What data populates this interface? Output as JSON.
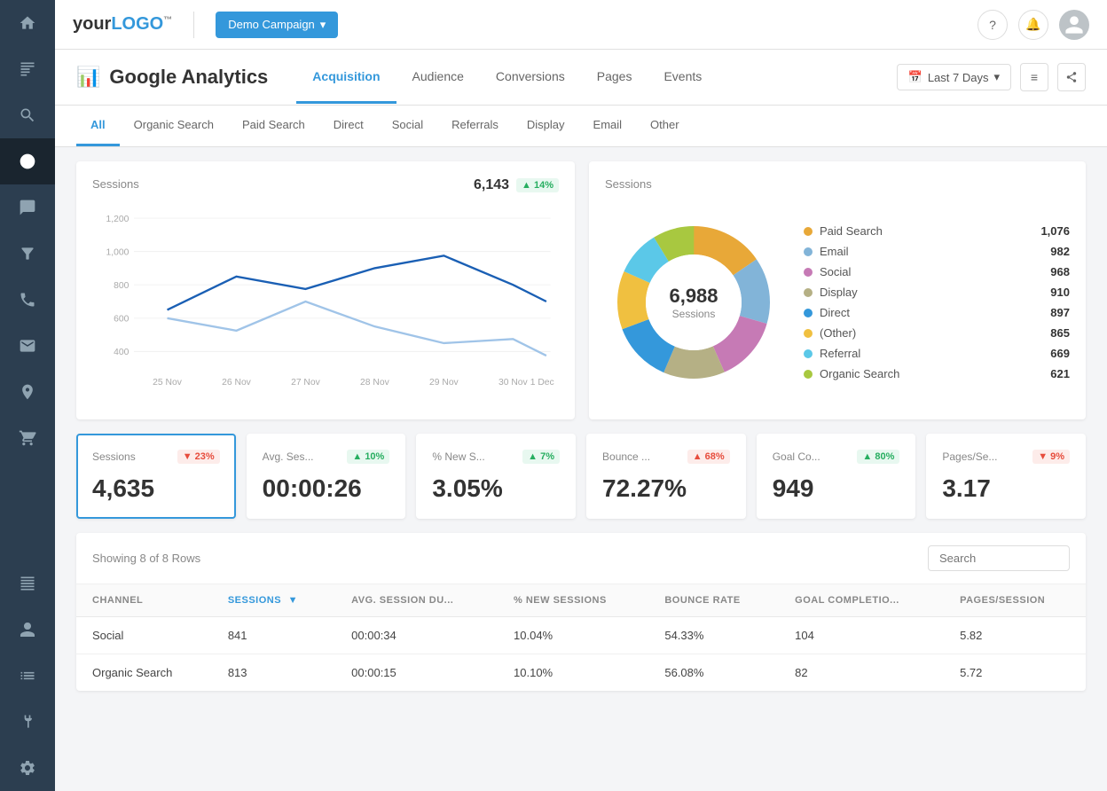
{
  "app": {
    "logo": "your LOGO",
    "logo_tm": "™"
  },
  "topbar": {
    "campaign_btn": "Demo Campaign",
    "help_icon": "?",
    "bell_icon": "🔔"
  },
  "page": {
    "title_icon": "📊",
    "title": "Google Analytics",
    "tabs": [
      {
        "label": "Acquisition",
        "active": true
      },
      {
        "label": "Audience",
        "active": false
      },
      {
        "label": "Conversions",
        "active": false
      },
      {
        "label": "Pages",
        "active": false
      },
      {
        "label": "Events",
        "active": false
      }
    ],
    "date_range": "Last 7 Days"
  },
  "filter_tabs": [
    {
      "label": "All",
      "active": true
    },
    {
      "label": "Organic Search",
      "active": false
    },
    {
      "label": "Paid Search",
      "active": false
    },
    {
      "label": "Direct",
      "active": false
    },
    {
      "label": "Social",
      "active": false
    },
    {
      "label": "Referrals",
      "active": false
    },
    {
      "label": "Display",
      "active": false
    },
    {
      "label": "Email",
      "active": false
    },
    {
      "label": "Other",
      "active": false
    }
  ],
  "line_chart": {
    "title": "Sessions",
    "value": "6,143",
    "badge": "▲ 14%",
    "badge_type": "up",
    "y_labels": [
      "1,200",
      "1,000",
      "800",
      "600",
      "400"
    ],
    "x_labels": [
      "25 Nov",
      "26 Nov",
      "27 Nov",
      "28 Nov",
      "29 Nov",
      "30 Nov",
      "1 Dec"
    ]
  },
  "donut_chart": {
    "title": "Sessions",
    "center_value": "6,988",
    "center_label": "Sessions",
    "legend": [
      {
        "label": "Paid Search",
        "value": "1,076",
        "color": "#e8a838"
      },
      {
        "label": "Email",
        "value": "982",
        "color": "#82b4d8"
      },
      {
        "label": "Social",
        "value": "968",
        "color": "#c67ab5"
      },
      {
        "label": "Display",
        "value": "910",
        "color": "#b5b085"
      },
      {
        "label": "Direct",
        "value": "897",
        "color": "#3498db"
      },
      {
        "label": "(Other)",
        "value": "865",
        "color": "#f0c040"
      },
      {
        "label": "Referral",
        "value": "669",
        "color": "#5bc8e8"
      },
      {
        "label": "Organic Search",
        "value": "621",
        "color": "#a8c840"
      }
    ]
  },
  "metrics": [
    {
      "label": "Sessions",
      "value": "4,635",
      "badge": "▼ 23%",
      "badge_type": "down",
      "selected": true
    },
    {
      "label": "Avg. Ses...",
      "value": "00:00:26",
      "badge": "▲ 10%",
      "badge_type": "up",
      "selected": false
    },
    {
      "label": "% New S...",
      "value": "3.05%",
      "badge": "▲ 7%",
      "badge_type": "up",
      "selected": false
    },
    {
      "label": "Bounce ...",
      "value": "72.27%",
      "badge": "▲ 68%",
      "badge_type": "down",
      "selected": false
    },
    {
      "label": "Goal Co...",
      "value": "949",
      "badge": "▲ 80%",
      "badge_type": "up",
      "selected": false
    },
    {
      "label": "Pages/Se...",
      "value": "3.17",
      "badge": "▼ 9%",
      "badge_type": "down",
      "selected": false
    }
  ],
  "table": {
    "info": "Showing 8 of 8 Rows",
    "search_placeholder": "Search",
    "columns": [
      "CHANNEL",
      "SESSIONS",
      "AVG. SESSION DU...",
      "% NEW SESSIONS",
      "BOUNCE RATE",
      "GOAL COMPLETIO...",
      "PAGES/SESSION"
    ],
    "rows": [
      {
        "channel": "Social",
        "sessions": "841",
        "avg_session": "00:00:34",
        "new_sessions": "10.04%",
        "bounce_rate": "54.33%",
        "goal_completions": "104",
        "pages_session": "5.82"
      },
      {
        "channel": "Organic Search",
        "sessions": "813",
        "avg_session": "00:00:15",
        "new_sessions": "10.10%",
        "bounce_rate": "56.08%",
        "goal_completions": "82",
        "pages_session": "5.72"
      }
    ]
  }
}
